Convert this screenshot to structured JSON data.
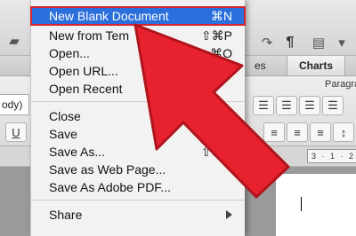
{
  "toolbar": {
    "pilcrow": "¶"
  },
  "ribbon": {
    "charts_tab": "Charts",
    "partial_tab": "es",
    "paragraph_label": "Paragra",
    "style_box": "ody)",
    "underline": "U"
  },
  "ruler": {
    "scale": "3 · 1 · 2"
  },
  "menu": {
    "items": [
      {
        "label": "New Blank Document",
        "shortcut": "⌘N"
      },
      {
        "label": "New from Tem",
        "shortcut": "⇧⌘P"
      },
      {
        "label": "Open...",
        "shortcut": "⌘O"
      },
      {
        "label": "Open URL...",
        "shortcut": ""
      },
      {
        "label": "Open Recent",
        "shortcut": ""
      },
      {
        "label": "Close",
        "shortcut": ""
      },
      {
        "label": "Save",
        "shortcut": "⌘S"
      },
      {
        "label": "Save As...",
        "shortcut": "⇧⌘S"
      },
      {
        "label": "Save as Web Page...",
        "shortcut": ""
      },
      {
        "label": "Save As Adobe PDF...",
        "shortcut": ""
      },
      {
        "label": "Share",
        "shortcut": ""
      }
    ]
  },
  "colors": {
    "highlight": "#2a6fdb",
    "arrow": "#e8212e"
  }
}
